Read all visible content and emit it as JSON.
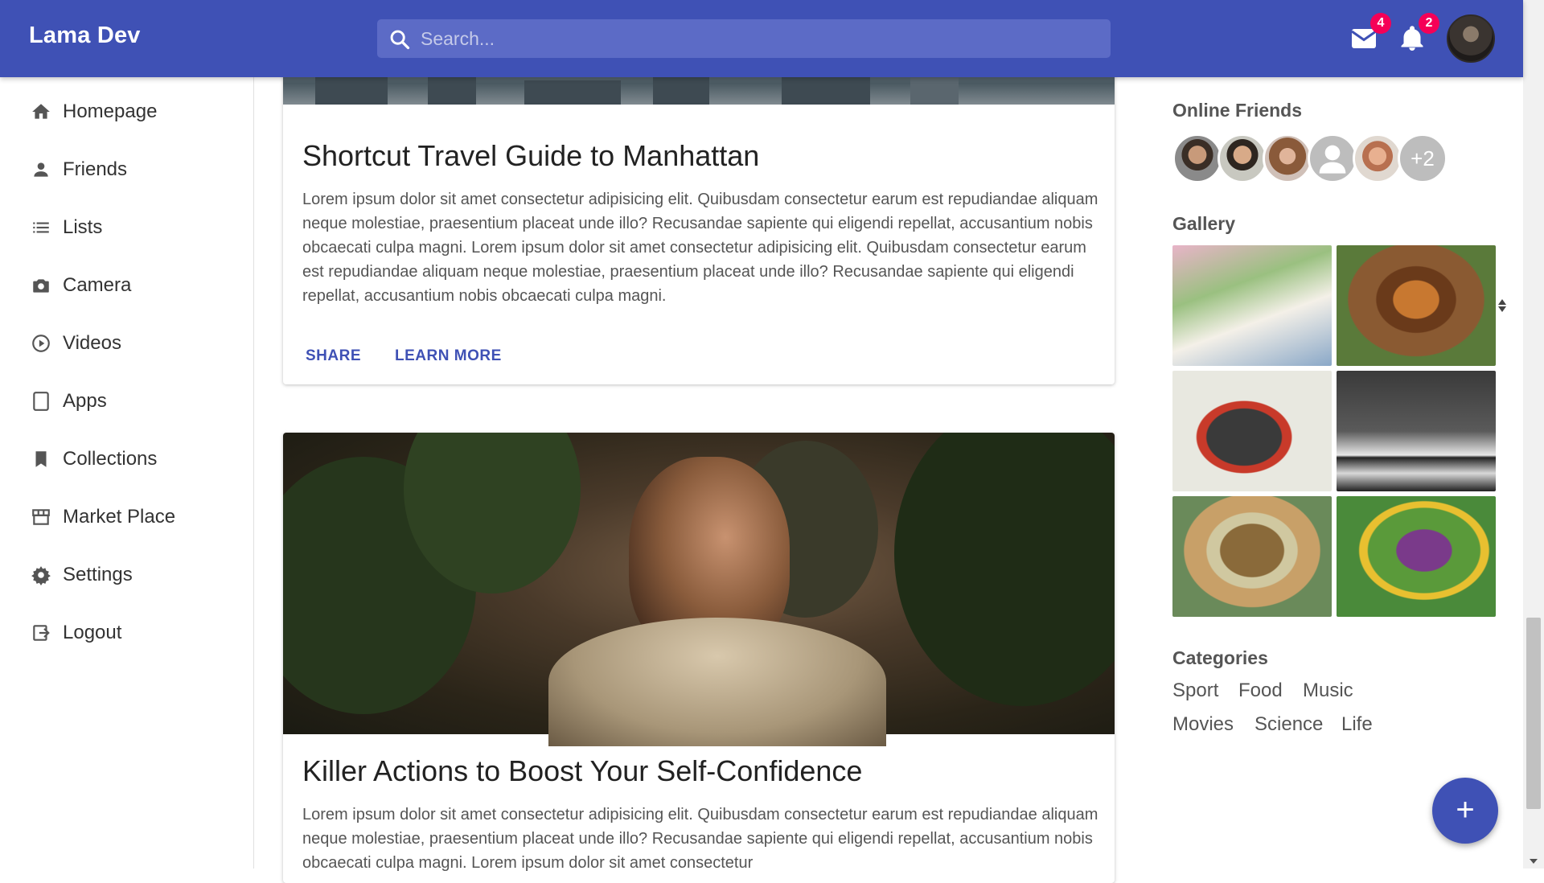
{
  "header": {
    "brand": "Lama Dev",
    "search_placeholder": "Search...",
    "mail_count": "4",
    "notification_count": "2"
  },
  "sidebar": {
    "items": [
      {
        "label": "Homepage",
        "icon": "home-icon"
      },
      {
        "label": "Friends",
        "icon": "person-icon"
      },
      {
        "label": "Lists",
        "icon": "list-icon"
      },
      {
        "label": "Camera",
        "icon": "camera-icon"
      },
      {
        "label": "Videos",
        "icon": "play-circle-icon"
      },
      {
        "label": "Apps",
        "icon": "tablet-icon"
      },
      {
        "label": "Collections",
        "icon": "bookmark-icon"
      },
      {
        "label": "Market Place",
        "icon": "storefront-icon"
      },
      {
        "label": "Settings",
        "icon": "gear-icon"
      },
      {
        "label": "Logout",
        "icon": "logout-icon"
      }
    ]
  },
  "posts": [
    {
      "title": "Shortcut Travel Guide to Manhattan",
      "body": "Lorem ipsum dolor sit amet consectetur adipisicing elit. Quibusdam consectetur earum est repudiandae aliquam neque molestiae, praesentium placeat unde illo? Recusandae sapiente qui eligendi repellat, accusantium nobis obcaecati culpa magni. Lorem ipsum dolor sit amet consectetur adipisicing elit. Quibusdam consectetur earum est repudiandae aliquam neque molestiae, praesentium placeat unde illo? Recusandae sapiente qui eligendi repellat, accusantium nobis obcaecati culpa magni.",
      "share_label": "SHARE",
      "learn_label": "LEARN MORE"
    },
    {
      "title": "Killer Actions to Boost Your Self-Confidence",
      "body": "Lorem ipsum dolor sit amet consectetur adipisicing elit. Quibusdam consectetur earum est repudiandae aliquam neque molestiae, praesentium placeat unde illo? Recusandae sapiente qui eligendi repellat, accusantium nobis obcaecati culpa magni. Lorem ipsum dolor sit amet consectetur"
    }
  ],
  "right_panel": {
    "online_friends_heading": "Online Friends",
    "friends_more": "+2",
    "gallery_heading": "Gallery",
    "categories_heading": "Categories",
    "categories": [
      "Sport",
      "Food",
      "Music",
      "Movies",
      "Science",
      "Life"
    ]
  },
  "fab_label": "+",
  "colors": {
    "primary": "#3f51b5",
    "badge": "#f50057"
  }
}
